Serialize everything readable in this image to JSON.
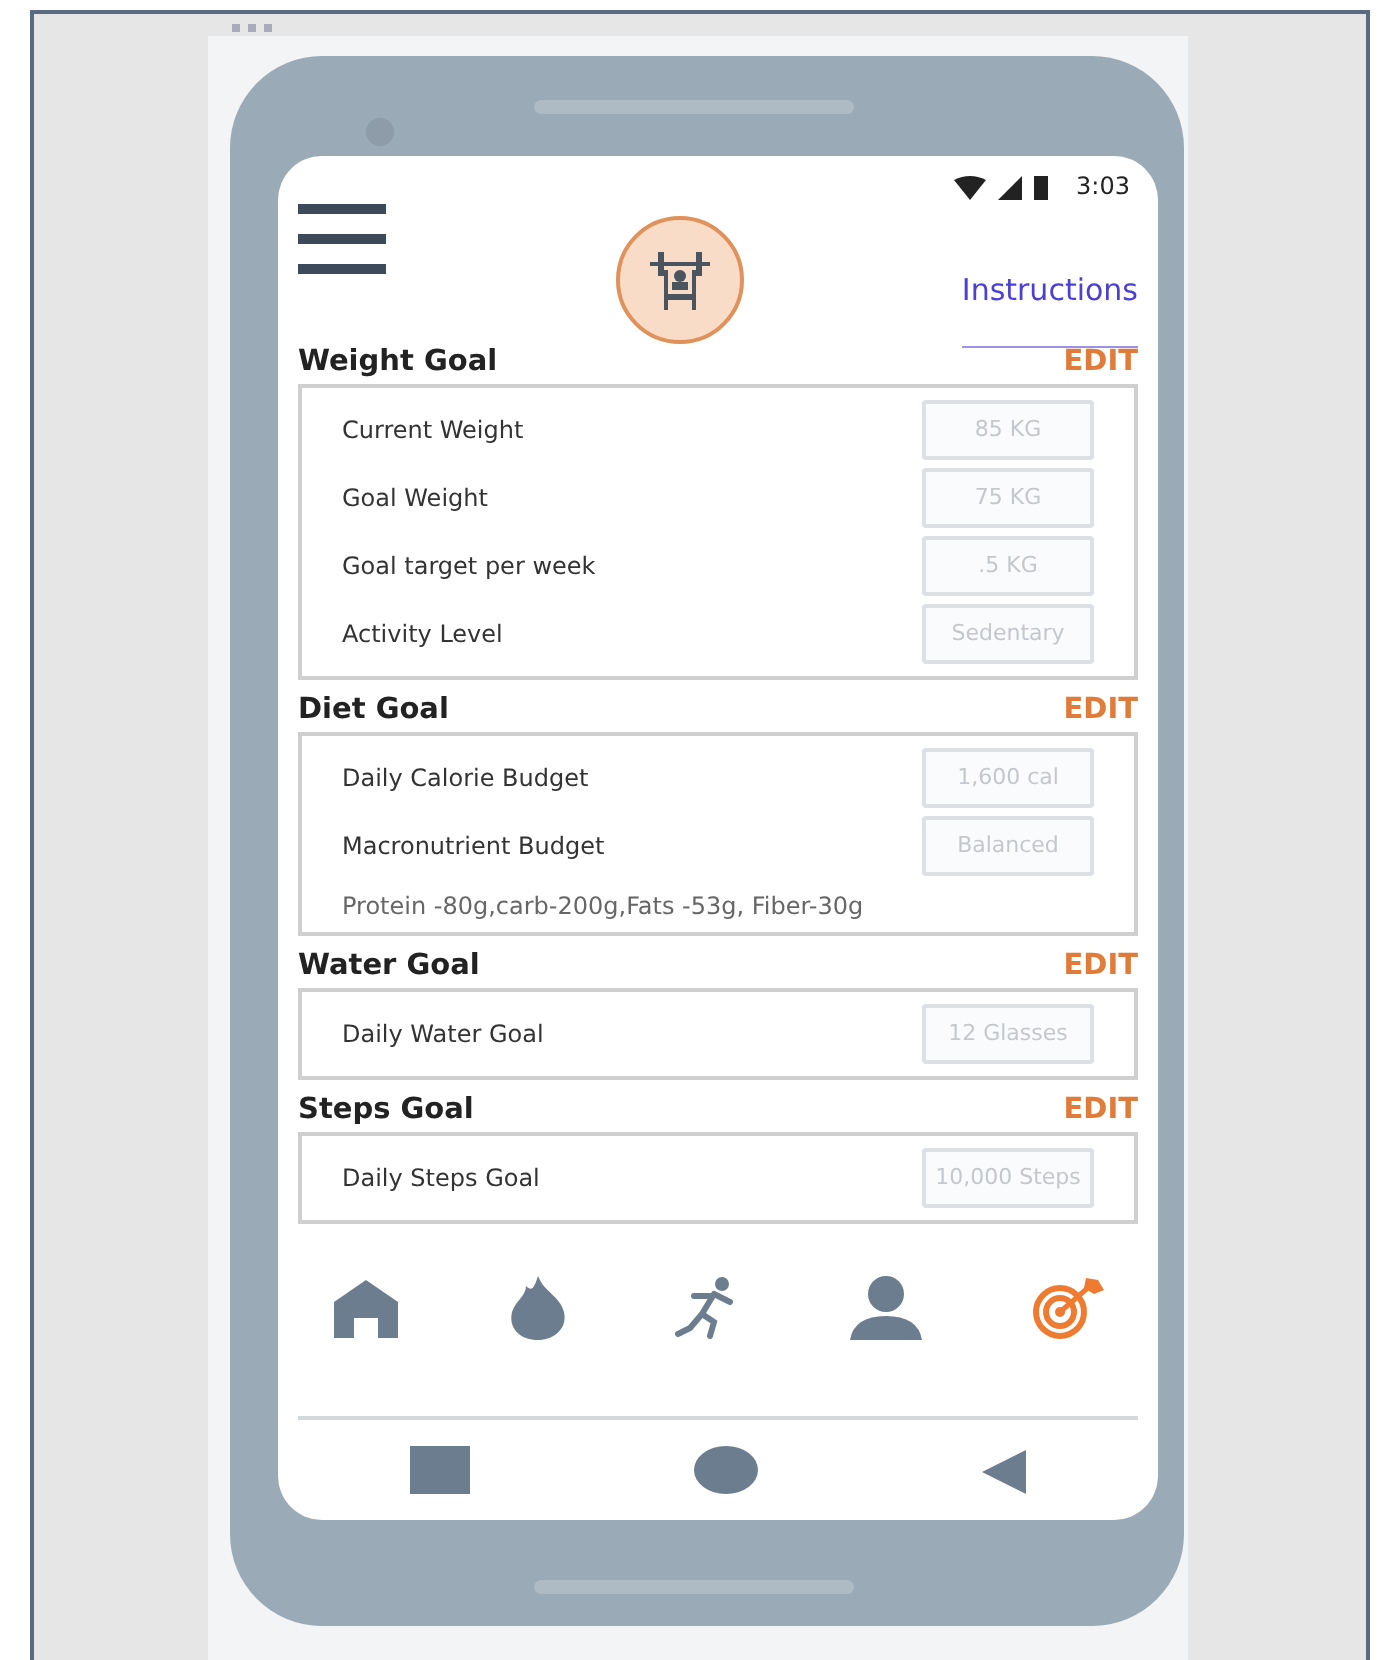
{
  "status_bar": {
    "time": "3:03"
  },
  "header": {
    "link": "Instructions"
  },
  "sections": [
    {
      "title": "Weight Goal",
      "action": "EDIT",
      "rows": [
        {
          "label": "Current Weight",
          "value": "85 KG"
        },
        {
          "label": "Goal Weight",
          "value": "75 KG"
        },
        {
          "label": "Goal target per week",
          "value": ".5 KG"
        },
        {
          "label": "Activity Level",
          "value": "Sedentary"
        }
      ]
    },
    {
      "title": "Diet Goal",
      "action": "EDIT",
      "rows": [
        {
          "label": "Daily Calorie Budget",
          "value": "1,600 cal"
        },
        {
          "label": "Macronutrient Budget",
          "value": "Balanced"
        }
      ],
      "note": "Protein -80g,carb-200g,Fats -53g, Fiber-30g"
    },
    {
      "title": "Water Goal",
      "action": "EDIT",
      "rows": [
        {
          "label": "Daily Water Goal",
          "value": "12 Glasses"
        }
      ]
    },
    {
      "title": "Steps Goal",
      "action": "EDIT",
      "rows": [
        {
          "label": "Daily Steps Goal",
          "value": "10,000 Steps"
        }
      ]
    }
  ],
  "tab_bar": [
    {
      "kind": "home",
      "selected": false
    },
    {
      "kind": "flame",
      "selected": false
    },
    {
      "kind": "runner",
      "selected": false
    },
    {
      "kind": "person",
      "selected": false
    },
    {
      "kind": "target",
      "selected": true
    }
  ],
  "system_nav": [
    {
      "kind": "recents"
    },
    {
      "kind": "home"
    },
    {
      "kind": "back"
    }
  ]
}
